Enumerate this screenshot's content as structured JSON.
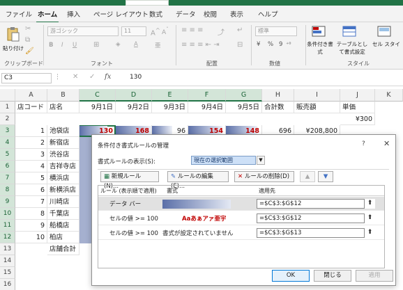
{
  "ribbon": {
    "tabs": [
      "ファイル",
      "ホーム",
      "挿入",
      "ページ レイアウト",
      "数式",
      "データ",
      "校閲",
      "表示",
      "ヘルプ"
    ],
    "active_tab": "ホーム",
    "paste_label": "貼り付け",
    "font_name": "游ゴシック",
    "font_size": "11",
    "number_format": "標準",
    "percent": "%",
    "comma": "9",
    "conditional_label": "条件付き書式",
    "table_label": "テーブルとして書式設定",
    "cell_label": "セル スタイル",
    "groups": [
      "クリップボード",
      "フォント",
      "配置",
      "数値",
      "スタイル"
    ]
  },
  "formula_bar": {
    "name_box": "C3",
    "fx": "fx",
    "value": "130"
  },
  "sheet": {
    "columns": [
      "A",
      "B",
      "C",
      "D",
      "E",
      "F",
      "G",
      "H",
      "I",
      "J",
      "K"
    ],
    "rows": [
      "1",
      "2",
      "3",
      "4",
      "5",
      "6",
      "7",
      "8",
      "9",
      "10",
      "11",
      "12",
      "13",
      "14",
      "15",
      "16"
    ],
    "header_row": [
      "店コード",
      "店名",
      "9月1日",
      "9月2日",
      "9月3日",
      "9月4日",
      "9月5日",
      "合計数",
      "販売額",
      "単価"
    ],
    "unit_price": "¥300",
    "data_rows": [
      {
        "code": "1",
        "store": "池袋店",
        "d1": "130",
        "d2": "168",
        "d3": "96",
        "d4": "154",
        "d5": "148",
        "total": "696",
        "sales": "¥208,800"
      },
      {
        "code": "2",
        "store": "新宿店"
      },
      {
        "code": "3",
        "store": "渋谷店"
      },
      {
        "code": "4",
        "store": "吉祥寺店"
      },
      {
        "code": "5",
        "store": "横浜店"
      },
      {
        "code": "6",
        "store": "新横浜店"
      },
      {
        "code": "7",
        "store": "川崎店"
      },
      {
        "code": "8",
        "store": "千葉店"
      },
      {
        "code": "9",
        "store": "船橋店"
      },
      {
        "code": "10",
        "store": "柏店"
      }
    ],
    "footer_label": "店舗合計"
  },
  "dialog": {
    "title": "条件付き書式ルールの管理",
    "help": "?",
    "close": "✕",
    "show_rules_label": "書式ルールの表示(S):",
    "show_rules_value": "現在の選択範囲",
    "buttons": {
      "new": "新規ルール(N)...",
      "edit": "ルールの編集(E)...",
      "delete": "ルールの削除(D)",
      "up": "▲",
      "down": "▼"
    },
    "columns": [
      "ルール (表示順で適用)",
      "書式",
      "適用先"
    ],
    "rules": [
      {
        "rule": "データ バー",
        "format": "",
        "applies": "=$C$3:$G$12"
      },
      {
        "rule": "セルの値 >= 100",
        "format": "Aaあぁアァ亜宇",
        "applies": "=$C$3:$G$12"
      },
      {
        "rule": "セルの値 >= 100",
        "format": "書式が設定されていません",
        "applies": "=$C$3:$G$13"
      }
    ],
    "ok": "OK",
    "close_btn": "閉じる",
    "apply": "適用",
    "accent": "#c00000"
  }
}
